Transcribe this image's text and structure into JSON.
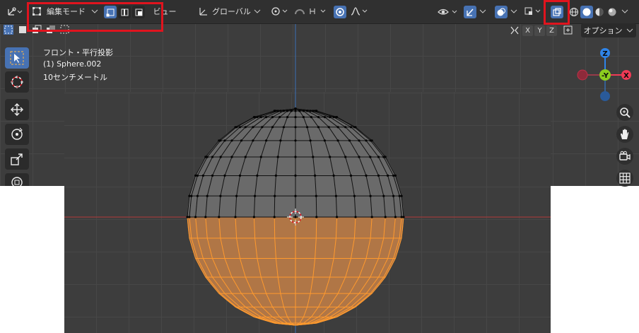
{
  "header": {
    "mode_label": "編集モード",
    "view_label": "ビュー",
    "transform_orientation": "グローバル",
    "options_label": "オプション",
    "axis_x": "X",
    "axis_y": "Y",
    "axis_z": "Z"
  },
  "overlay": {
    "view_name": "フロント・平行投影",
    "object_name": "(1) Sphere.002",
    "scale": "10センチメートル"
  },
  "gizmo": {
    "z": "Z",
    "y": "-Y",
    "x": "X"
  },
  "colors": {
    "accent": "#4772b3",
    "highlight": "#e0141e",
    "selected": "#ff9a2e",
    "axis_x": "#f03a55",
    "axis_y": "#8ccc1f",
    "axis_z": "#2f84e8"
  },
  "icons": [
    "editor-type-icon",
    "mesh-mode-icon",
    "vertex-select-icon",
    "edge-select-icon",
    "face-select-icon",
    "transform-orientation-icon",
    "pivot-icon",
    "snap-icon",
    "proportional-edit-icon",
    "falloff-icon",
    "visibility-icon",
    "gizmo-icon",
    "overlay-icon",
    "xray-icon",
    "wireframe-shading-icon",
    "solid-shading-icon",
    "material-shading-icon",
    "rendered-shading-icon",
    "select-box-icon",
    "cursor-icon",
    "move-icon",
    "rotate-icon",
    "scale-icon",
    "transform-icon",
    "zoom-icon",
    "pan-hand-icon",
    "camera-icon",
    "grid-icon"
  ]
}
